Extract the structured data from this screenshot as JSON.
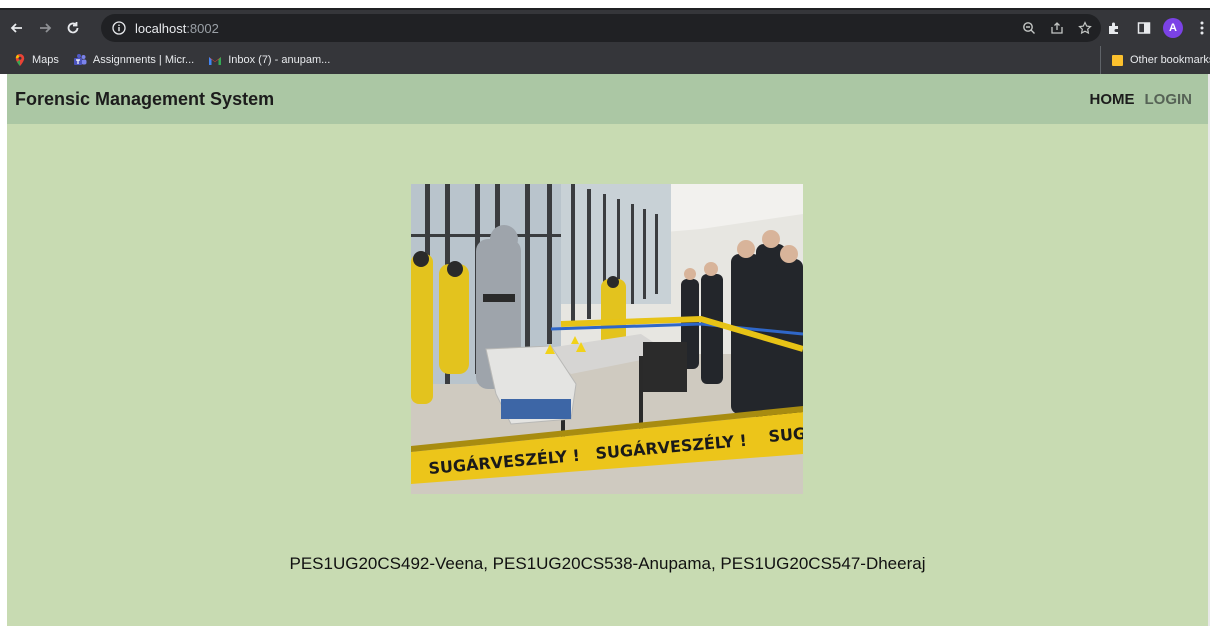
{
  "browser": {
    "url_host": "localhost",
    "url_port": ":8002",
    "avatar_letter": "A",
    "bookmarks": [
      {
        "label": "Maps",
        "icon": "maps-pin-icon"
      },
      {
        "label": "Assignments | Micr...",
        "icon": "teams-icon"
      },
      {
        "label": "Inbox (7) - anupam...",
        "icon": "gmail-icon"
      }
    ],
    "other_bookmarks": "Other bookmarks"
  },
  "navbar": {
    "brand": "Forensic Management System",
    "home": "HOME",
    "login": "LOGIN"
  },
  "hero": {
    "tape_text_1": "SUGÁRVESZÉLY !",
    "tape_text_2": "SUGÁRVESZÉLY !",
    "tape_text_3": "SUGÁ"
  },
  "footer": {
    "credits": "PES1UG20CS492-Veena, PES1UG20CS538-Anupama, PES1UG20CS547-Dheeraj"
  }
}
